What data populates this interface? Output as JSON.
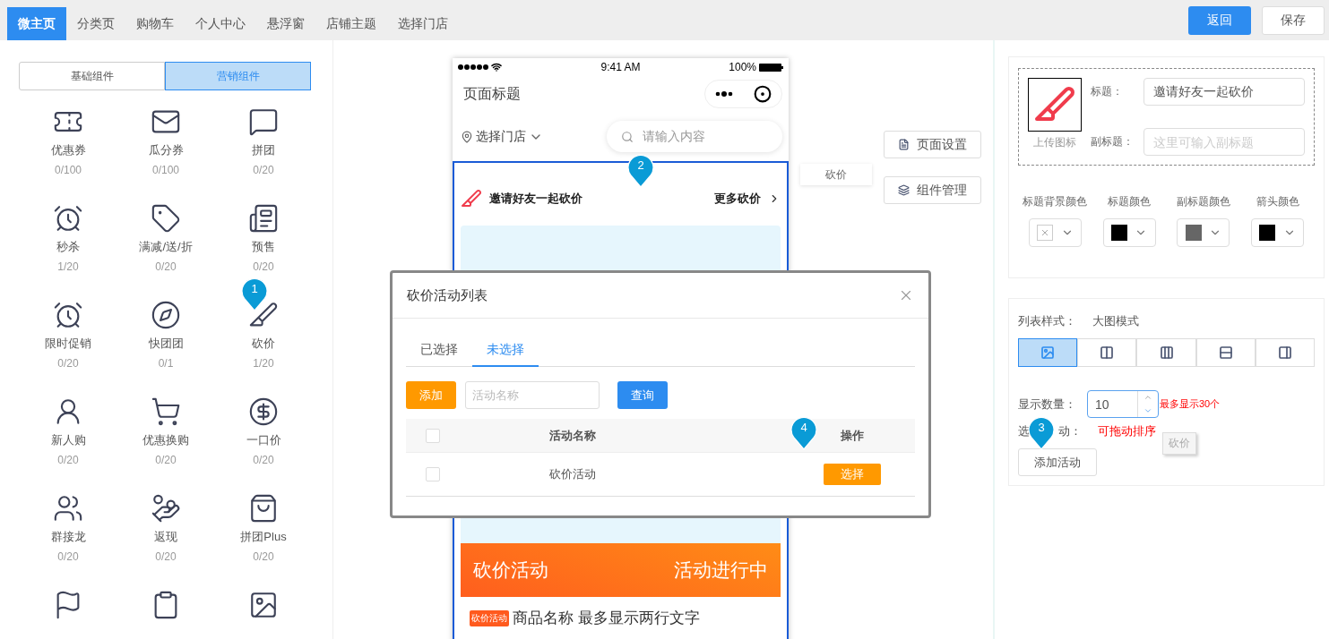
{
  "top_tabs": [
    {
      "label": "微主页",
      "selected": true
    },
    {
      "label": "分类页",
      "selected": false
    },
    {
      "label": "购物车",
      "selected": false
    },
    {
      "label": "个人中心",
      "selected": false
    },
    {
      "label": "悬浮窗",
      "selected": false
    },
    {
      "label": "店铺主题",
      "selected": false
    },
    {
      "label": "选择门店",
      "selected": false
    }
  ],
  "top_actions": [
    {
      "label": "返回",
      "kind": "primary"
    },
    {
      "label": "保存",
      "kind": "default"
    }
  ],
  "component_panel": {
    "groups": [
      {
        "label": "基础组件",
        "selected": false
      },
      {
        "label": "营销组件",
        "selected": true
      }
    ],
    "items": [
      {
        "label": "优惠券",
        "count": "0/100"
      },
      {
        "label": "瓜分券",
        "count": "0/100"
      },
      {
        "label": "拼团",
        "count": "0/20"
      },
      {
        "label": "秒杀",
        "count": "1/20"
      },
      {
        "label": "满减/送/折",
        "count": "0/20"
      },
      {
        "label": "预售",
        "count": "0/20"
      },
      {
        "label": "限时促销",
        "count": "0/20"
      },
      {
        "label": "快团团",
        "count": "0/1"
      },
      {
        "label": "砍价",
        "count": "1/20"
      },
      {
        "label": "新人购",
        "count": "0/20"
      },
      {
        "label": "优惠换购",
        "count": "0/20"
      },
      {
        "label": "一口价",
        "count": "0/20"
      },
      {
        "label": "群接龙",
        "count": "0/20"
      },
      {
        "label": "返现",
        "count": "0/20"
      },
      {
        "label": "拼团Plus",
        "count": "0/20"
      }
    ]
  },
  "phone": {
    "time": "9:41 AM",
    "battery": "100%",
    "page_title": "页面标题",
    "store": "选择门店",
    "search_placeholder": "请输入内容",
    "block": {
      "title": "邀请好友一起砍价",
      "more": "更多砍价",
      "banner_left": "砍价活动",
      "banner_right": "活动进行中",
      "tag": "砍价活动",
      "product": "商品名称 最多显示两行文字"
    }
  },
  "drag_tooltip": "砍价",
  "side_buttons": [
    {
      "label": "页面设置",
      "kind": "page"
    },
    {
      "label": "组件管理",
      "kind": "layers"
    }
  ],
  "settings": {
    "upload_label": "上传图标",
    "title_label": "标题：",
    "title_value": "邀请好友一起砍价",
    "subtitle_label": "副标题：",
    "subtitle_placeholder": "这里可输入副标题",
    "colors": [
      {
        "label": "标题背景颜色"
      },
      {
        "label": "标题颜色",
        "color": "#000000"
      },
      {
        "label": "副标题颜色",
        "color": "#666666"
      },
      {
        "label": "箭头颜色",
        "color": "#000000"
      }
    ],
    "list_style_label": "列表样式：",
    "list_style_value": "大图模式",
    "list_styles": [
      {
        "selected": true
      },
      {
        "selected": false
      },
      {
        "selected": false
      },
      {
        "selected": false
      },
      {
        "selected": false
      }
    ],
    "count_label": "显示数量：",
    "count_value": "10",
    "count_hint": "最多显示30个",
    "activity_label_parts": [
      "选",
      "动："
    ],
    "activity_hint": "可拖动排序",
    "dragged_chip": "砍价",
    "add_button": "添加活动"
  },
  "modal": {
    "title": "砍价活动列表",
    "tabs": [
      {
        "label": "已选择",
        "selected": false
      },
      {
        "label": "未选择",
        "selected": true
      }
    ],
    "add_button": "添加",
    "search_placeholder": "活动名称",
    "query_button": "查询",
    "header_checked": false,
    "columns": [
      "活动名称",
      "操作"
    ],
    "rows": [
      {
        "checked": false,
        "name": "砍价活动",
        "action": "选择"
      }
    ]
  },
  "markers": [
    "1",
    "2",
    "3",
    "4"
  ]
}
